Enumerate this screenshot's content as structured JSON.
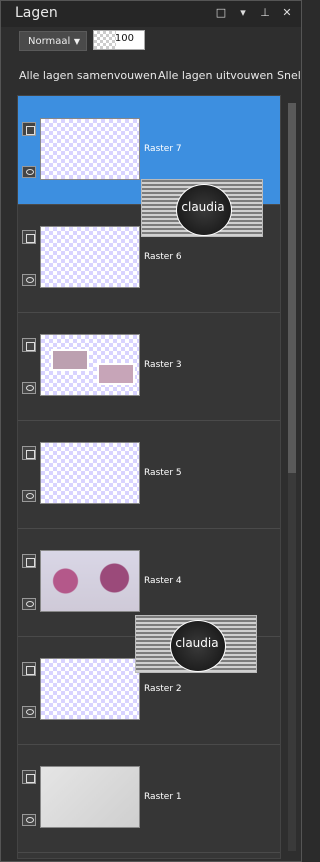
{
  "panel": {
    "title": "Lagen",
    "blend_mode": "Normaal",
    "opacity": "100",
    "actions": [
      "Alle lagen samenvouwen",
      "Alle lagen uitvouwen",
      "Snel"
    ]
  },
  "layers": [
    {
      "name": "Raster 7",
      "selected": true
    },
    {
      "name": "Raster 6"
    },
    {
      "name": "Raster 3"
    },
    {
      "name": "Raster 5"
    },
    {
      "name": "Raster 4"
    },
    {
      "name": "Raster 2"
    },
    {
      "name": "Raster 1"
    }
  ],
  "watermark": {
    "text": "claudia"
  }
}
